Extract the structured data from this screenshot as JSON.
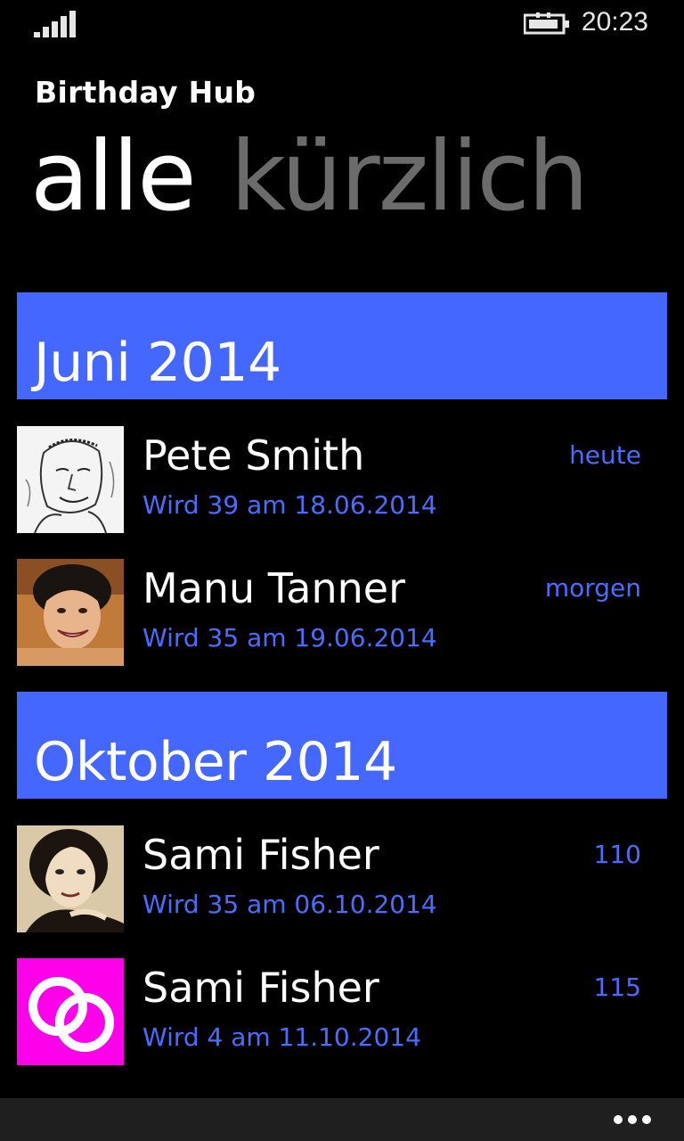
{
  "status": {
    "time": "20:23"
  },
  "app": {
    "title": "Birthday Hub"
  },
  "pivot": {
    "tabs": [
      "alle",
      "kürzlich"
    ]
  },
  "groups": [
    {
      "header": "Juni 2014",
      "items": [
        {
          "name": "Pete Smith",
          "detail": "Wird 39 am 18.06.2014",
          "right": "heute",
          "avatar": "sketch-portrait-man"
        },
        {
          "name": "Manu Tanner",
          "detail": "Wird 35 am 19.06.2014",
          "right": "morgen",
          "avatar": "photo-portrait-woman"
        }
      ]
    },
    {
      "header": "Oktober 2014",
      "items": [
        {
          "name": "Sami Fisher",
          "detail": "Wird 35 am 06.10.2014",
          "right": "110",
          "avatar": "photo-portrait-woman-2"
        },
        {
          "name": "Sami Fisher",
          "detail": "Wird 4 am 11.10.2014",
          "right": "115",
          "avatar": "wedding-rings-icon"
        }
      ]
    }
  ],
  "colors": {
    "accent": "#4468ff",
    "rings_bg": "#ff00ea"
  }
}
